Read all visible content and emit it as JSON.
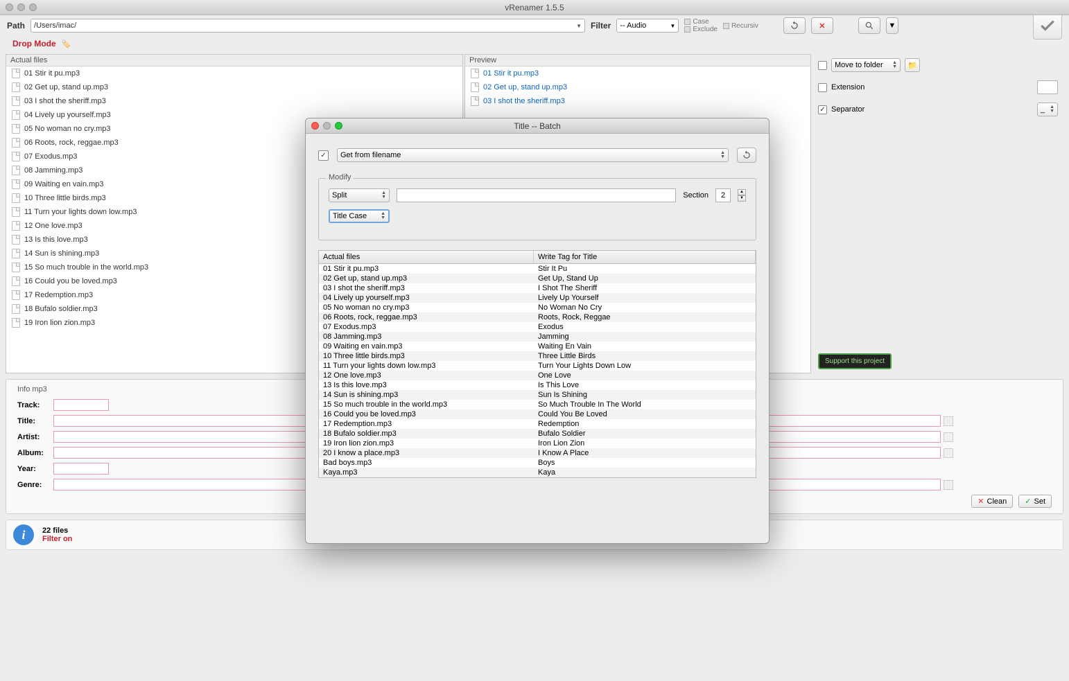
{
  "window": {
    "title": "vRenamer 1.5.5"
  },
  "toolbar": {
    "path_label": "Path",
    "path_value": "/Users/imac/",
    "filter_label": "Filter",
    "filter_value": "-- Audio",
    "case_label": "Case",
    "exclude_label": "Exclude",
    "recursiv_label": "Recursiv"
  },
  "dropmode": {
    "label": "Drop Mode"
  },
  "actual": {
    "header": "Actual files",
    "files": [
      "01 Stir it pu.mp3",
      "02 Get up, stand up.mp3",
      "03 I shot the sheriff.mp3",
      "04 Lively up yourself.mp3",
      "05 No woman no cry.mp3",
      "06 Roots, rock, reggae.mp3",
      "07 Exodus.mp3",
      "08 Jamming.mp3",
      "09 Waiting en vain.mp3",
      "10 Three little birds.mp3",
      "11 Turn your lights down low.mp3",
      "12 One love.mp3",
      "13 Is this love.mp3",
      "14 Sun is shining.mp3",
      "15 So much trouble in the world.mp3",
      "16 Could you be loved.mp3",
      "17 Redemption.mp3",
      "18 Bufalo soldier.mp3",
      "19 Iron lion zion.mp3"
    ]
  },
  "preview": {
    "header": "Preview",
    "files": [
      "01 Stir it pu.mp3",
      "02 Get up, stand up.mp3",
      "03 I shot the sheriff.mp3"
    ]
  },
  "side": {
    "move_label": "Move to folder",
    "ext_label": "Extension",
    "sep_label": "Separator",
    "sep_value": "_",
    "support": "Support this project"
  },
  "info": {
    "header": "Info mp3",
    "track": "Track:",
    "title": "Title:",
    "artist": "Artist:",
    "album": "Album:",
    "year": "Year:",
    "genre": "Genre:",
    "clean": "Clean",
    "set": "Set"
  },
  "status": {
    "count": "22 files",
    "filter": "Filter on"
  },
  "modal": {
    "title": "Title -- Batch",
    "source": "Get from filename",
    "modify_legend": "Modify",
    "split": "Split",
    "titlecase": "Title Case",
    "section_label": "Section",
    "section_value": "2",
    "col_actual": "Actual files",
    "col_write": "Write Tag for Title",
    "rows": [
      {
        "a": "01 Stir it pu.mp3",
        "b": "Stir It Pu"
      },
      {
        "a": "02 Get up, stand up.mp3",
        "b": "Get Up, Stand Up"
      },
      {
        "a": "03 I shot the sheriff.mp3",
        "b": "I Shot The Sheriff"
      },
      {
        "a": "04 Lively up yourself.mp3",
        "b": "Lively Up Yourself"
      },
      {
        "a": "05 No woman no cry.mp3",
        "b": "No Woman No Cry"
      },
      {
        "a": "06 Roots, rock, reggae.mp3",
        "b": "Roots, Rock, Reggae"
      },
      {
        "a": "07 Exodus.mp3",
        "b": "Exodus"
      },
      {
        "a": "08 Jamming.mp3",
        "b": "Jamming"
      },
      {
        "a": "09 Waiting en vain.mp3",
        "b": "Waiting En Vain"
      },
      {
        "a": "10 Three little birds.mp3",
        "b": "Three Little Birds"
      },
      {
        "a": "11 Turn your lights down low.mp3",
        "b": "Turn Your Lights Down Low"
      },
      {
        "a": "12 One love.mp3",
        "b": "One Love"
      },
      {
        "a": "13 Is this love.mp3",
        "b": "Is This Love"
      },
      {
        "a": "14 Sun is shining.mp3",
        "b": "Sun Is Shining"
      },
      {
        "a": "15 So much trouble in the world.mp3",
        "b": "So Much Trouble In The World"
      },
      {
        "a": "16 Could you be loved.mp3",
        "b": "Could You Be Loved"
      },
      {
        "a": "17 Redemption.mp3",
        "b": "Redemption"
      },
      {
        "a": "18 Bufalo soldier.mp3",
        "b": "Bufalo Soldier"
      },
      {
        "a": "19 Iron lion zion.mp3",
        "b": "Iron Lion Zion"
      },
      {
        "a": "20 I know a place.mp3",
        "b": "I Know A Place"
      },
      {
        "a": "Bad boys.mp3",
        "b": "Boys"
      },
      {
        "a": "Kaya.mp3",
        "b": "Kaya"
      }
    ]
  }
}
